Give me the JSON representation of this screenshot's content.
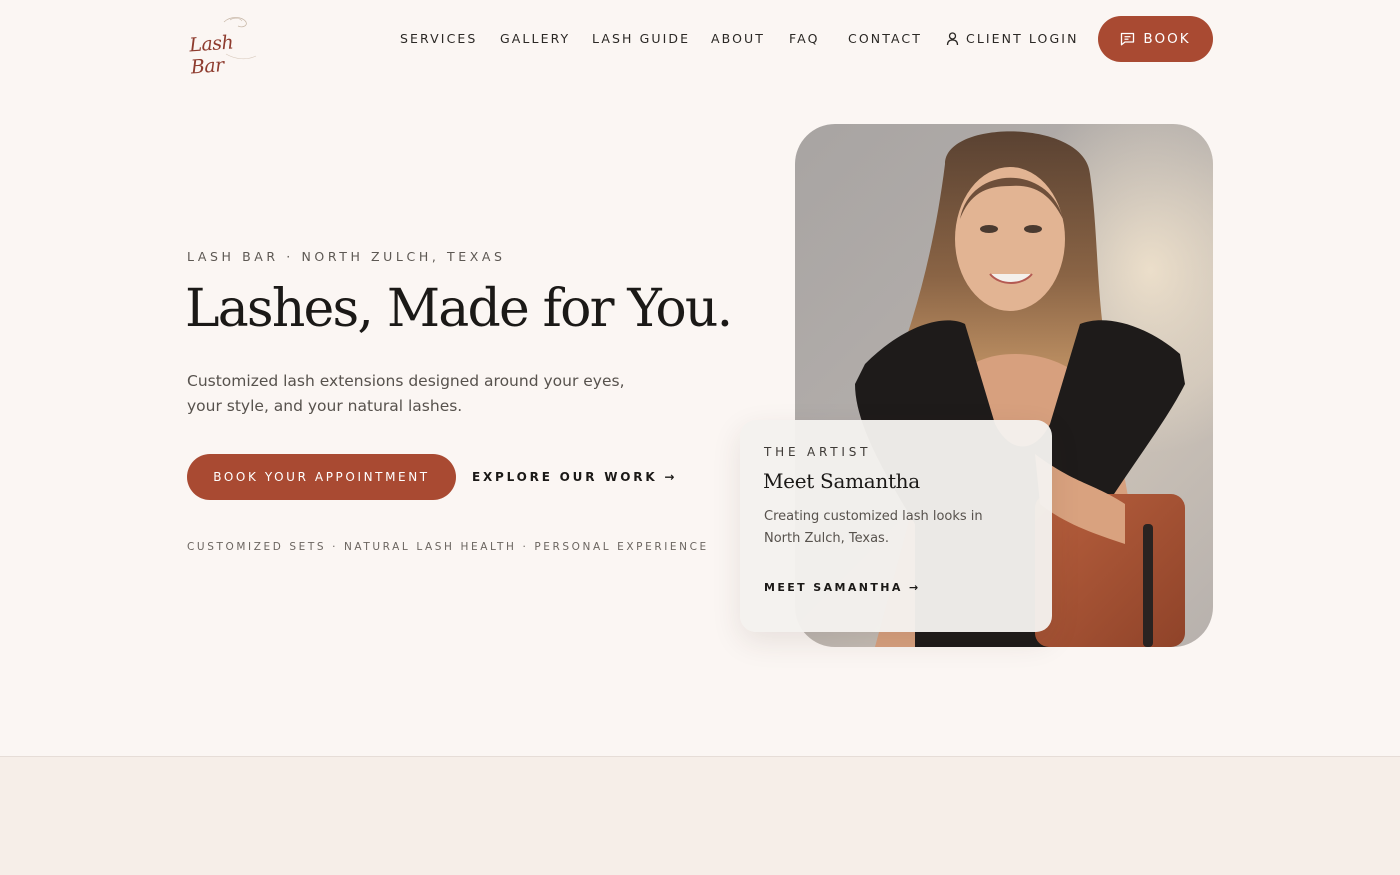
{
  "brand": {
    "logo_text": "Lash Bar"
  },
  "nav": {
    "items": [
      {
        "label": "SERVICES"
      },
      {
        "label": "GALLERY"
      },
      {
        "label": "LASH GUIDE"
      },
      {
        "label": "ABOUT"
      },
      {
        "label": "FAQ"
      },
      {
        "label": "CONTACT"
      }
    ],
    "client_login": "CLIENT LOGIN",
    "book": "BOOK"
  },
  "hero": {
    "eyebrow": "LASH BAR · NORTH ZULCH, TEXAS",
    "headline": "Lashes, Made for You.",
    "subtext": "Customized lash extensions designed around your eyes, your style, and your natural lashes.",
    "cta_primary": "BOOK YOUR APPOINTMENT",
    "cta_secondary": "EXPLORE OUR WORK →",
    "features": "CUSTOMIZED SETS · NATURAL LASH HEALTH · PERSONAL EXPERIENCE"
  },
  "artist": {
    "eyebrow": "THE ARTIST",
    "title": "Meet Samantha",
    "text": "Creating customized lash looks in North Zulch, Texas.",
    "link": "MEET SAMANTHA →"
  },
  "icons": {
    "user": "user-icon",
    "chat": "chat-icon"
  },
  "colors": {
    "accent": "#a94a32",
    "background": "#fbf6f3",
    "text": "#1b1917"
  }
}
